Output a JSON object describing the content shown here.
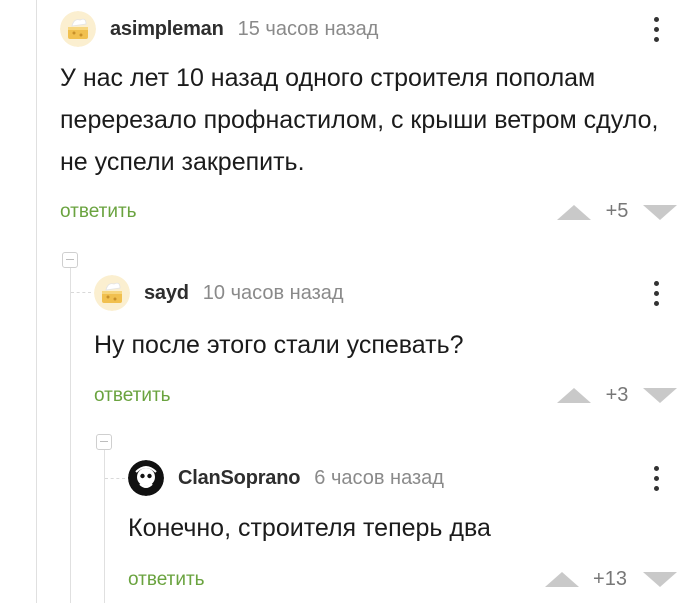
{
  "comments": [
    {
      "username": "asimpleman",
      "time": "15 часов назад",
      "text": "У нас лет 10 назад одного строителя пополам перерезало профнастилом, с крыши ветром сдуло, не успели закрепить.",
      "reply_label": "ответить",
      "rating": "+5"
    },
    {
      "username": "sayd",
      "time": "10 часов назад",
      "text": "Ну после этого стали успевать?",
      "reply_label": "ответить",
      "rating": "+3"
    },
    {
      "username": "ClanSoprano",
      "time": "6 часов назад",
      "text": "Конечно, строителя теперь два",
      "reply_label": "ответить",
      "rating": "+13"
    }
  ],
  "icons": {
    "more": "vertical-dots-icon",
    "upvote": "upvote-arrow-icon",
    "downvote": "downvote-arrow-icon",
    "collapse": "collapse-branch-icon"
  },
  "colors": {
    "reply": "#6aa33f",
    "vote_arrow": "#c9c9c9",
    "username": "#2e2e2e",
    "time": "#8a8a8a"
  }
}
